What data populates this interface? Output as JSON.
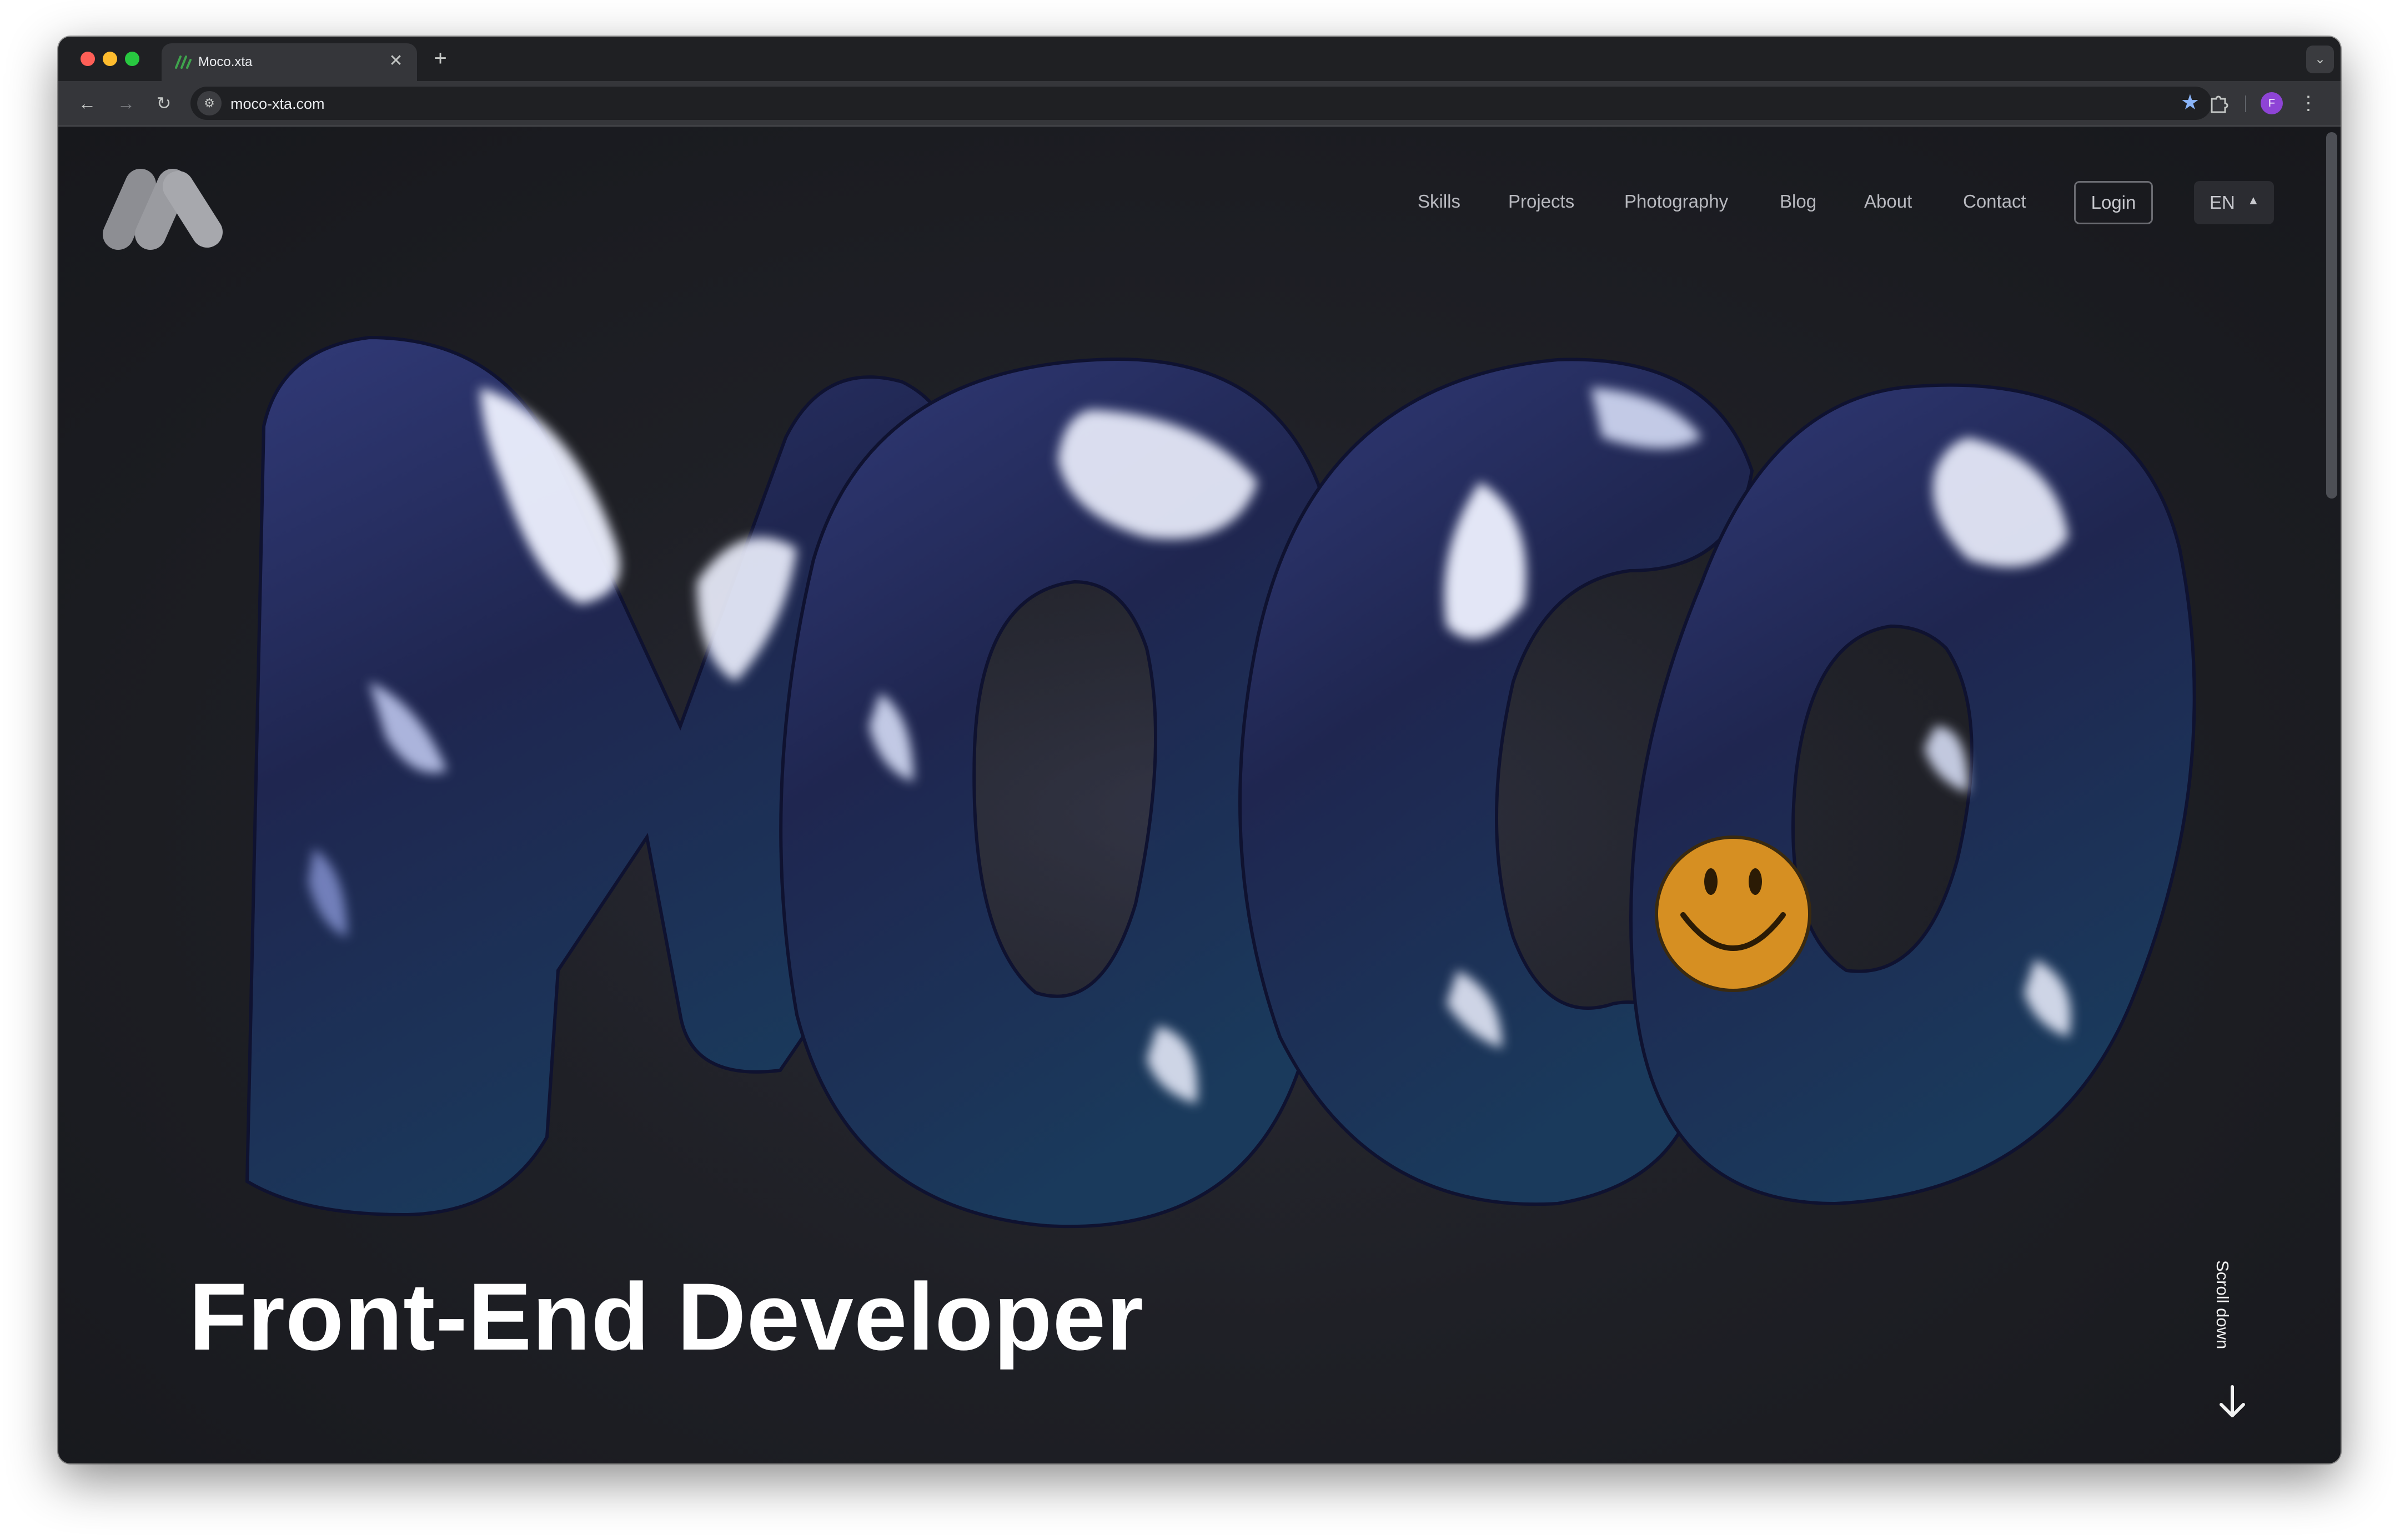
{
  "browser": {
    "tab": {
      "title": "Moco.xta",
      "close_glyph": "✕"
    },
    "new_tab_glyph": "+",
    "tab_dropdown_glyph": "⌄",
    "toolbar": {
      "back_glyph": "←",
      "forward_glyph": "→",
      "reload_glyph": "↻",
      "site_info_glyph": "⚙",
      "url": "moco-xta.com",
      "bookmark_glyph": "★",
      "profile_initial": "F",
      "menu_glyph": "⋮"
    }
  },
  "site": {
    "nav": {
      "links": [
        "Skills",
        "Projects",
        "Photography",
        "Blog",
        "About",
        "Contact"
      ],
      "login_label": "Login",
      "language": "EN",
      "language_caret": "▲"
    },
    "hero": {
      "headline": "Front-End Developer",
      "scroll_label": "Scroll down",
      "balloon_word": "MOCO"
    }
  },
  "colors": {
    "page_background": "#1b1c21",
    "balloon": "#232a55",
    "balloon_highlight": "#c9d4ff",
    "smiley": "#d68f22",
    "headline": "#ffffff",
    "nav_text": "#b8b9bf"
  },
  "icons": {
    "site_logo": "moco-m-logo",
    "tab_favicon": "moco-favicon",
    "extensions": "puzzle-icon",
    "scroll": "arrow-down-icon",
    "sticker": "smiley-face-icon"
  }
}
